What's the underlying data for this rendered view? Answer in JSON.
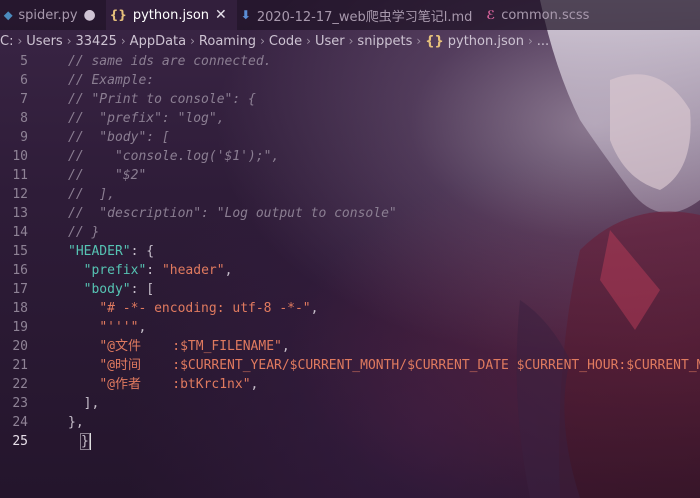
{
  "tabs": [
    {
      "icon": "python-icon",
      "label": "spider.py",
      "modified": "●",
      "active": false,
      "icon_color": "#4b8bbe"
    },
    {
      "icon": "json-icon",
      "label": "python.json",
      "close": "✕",
      "active": true,
      "icon_color": "#e5c07b"
    },
    {
      "icon": "markdown-icon",
      "label": "2020-12-17_web爬虫学习笔记l.md",
      "active": false,
      "icon_color": "#5b8dd6"
    },
    {
      "icon": "scss-icon",
      "label": "common.scss",
      "active": false,
      "icon_color": "#d6629a"
    }
  ],
  "breadcrumb": [
    "C:",
    "Users",
    "33425",
    "AppData",
    "Roaming",
    "Code",
    "User",
    "snippets",
    "python.json",
    "..."
  ],
  "breadcrumb_file_icon": "{}",
  "tab_icon_glyphs": {
    "json": "{}"
  },
  "lines": [
    {
      "n": "5",
      "text": "// same ids are connected."
    },
    {
      "n": "6",
      "text": "// Example:"
    },
    {
      "n": "7",
      "text": "// \"Print to console\": {"
    },
    {
      "n": "8",
      "text": "//  \"prefix\": \"log\","
    },
    {
      "n": "9",
      "text": "//  \"body\": ["
    },
    {
      "n": "10",
      "text": "//    \"console.log('$1');\","
    },
    {
      "n": "11",
      "text": "//    \"$2\""
    },
    {
      "n": "12",
      "text": "//  ],"
    },
    {
      "n": "13",
      "text": "//  \"description\": \"Log output to console\""
    },
    {
      "n": "14",
      "text": "// }"
    },
    {
      "n": "15",
      "key": "\"HEADER\"",
      "rest": ": {"
    },
    {
      "n": "16",
      "key": "\"prefix\"",
      "rest": ": ",
      "str": "\"header\"",
      "tail": ","
    },
    {
      "n": "17",
      "key": "\"body\"",
      "rest": ": ["
    },
    {
      "n": "18",
      "str": "\"# -*- encoding: utf-8 -*-\"",
      "tail": ","
    },
    {
      "n": "19",
      "str": "\"'''\"",
      "tail": ","
    },
    {
      "n": "20",
      "str": "\"@文件    :$TM_FILENAME\"",
      "tail": ","
    },
    {
      "n": "21",
      "str": "\"@时间    :$CURRENT_YEAR/$CURRENT_MONTH/$CURRENT_DATE $CURRENT_HOUR:$CURRENT_MI"
    },
    {
      "n": "22",
      "str": "\"@作者    :btKrc1nx\"",
      "tail": ","
    },
    {
      "n": "23",
      "plain": "],"
    },
    {
      "n": "24",
      "plain": "},"
    },
    {
      "n": "25",
      "plain": "}"
    }
  ]
}
